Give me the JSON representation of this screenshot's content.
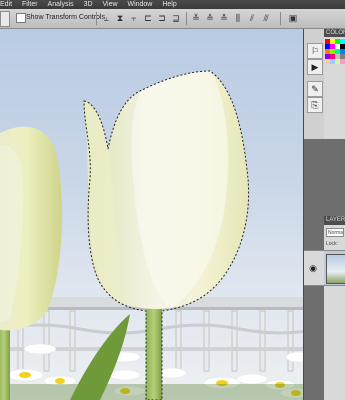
{
  "menu": {
    "items": [
      "Edit",
      "Filter",
      "Analysis",
      "3D",
      "View",
      "Window",
      "Help"
    ]
  },
  "options": {
    "show_transform_label": "Show Transform Controls",
    "align_icons": [
      "align-top-icon",
      "align-vcenter-icon",
      "align-bottom-icon",
      "align-left-icon",
      "align-hcenter-icon",
      "align-right-icon",
      "distribute-top-icon",
      "distribute-vcenter-icon",
      "distribute-bottom-icon",
      "distribute-left-icon",
      "distribute-hcenter-icon",
      "distribute-right-icon",
      "auto-align-icon"
    ]
  },
  "panels": {
    "color_title": "COLOR",
    "layers_title": "LAYERS",
    "blend_mode": "Normal",
    "lock_label": "Lock:",
    "swatches": [
      "#ff0000",
      "#ffff00",
      "#00ff00",
      "#00ffff",
      "#0000ff",
      "#ff00ff",
      "#ffffff",
      "#000000",
      "#ff7f00",
      "#7fff00",
      "#00ff7f",
      "#007fff",
      "#7f00ff",
      "#ff007f",
      "#c0c0c0",
      "#808080",
      "#ffcc99",
      "#99ccff",
      "#ccff99",
      "#ff99cc"
    ]
  },
  "colors": {
    "accent": "#bfc9d8",
    "menubar": "#3f3f3f",
    "workspace": "#6e6e6e"
  }
}
